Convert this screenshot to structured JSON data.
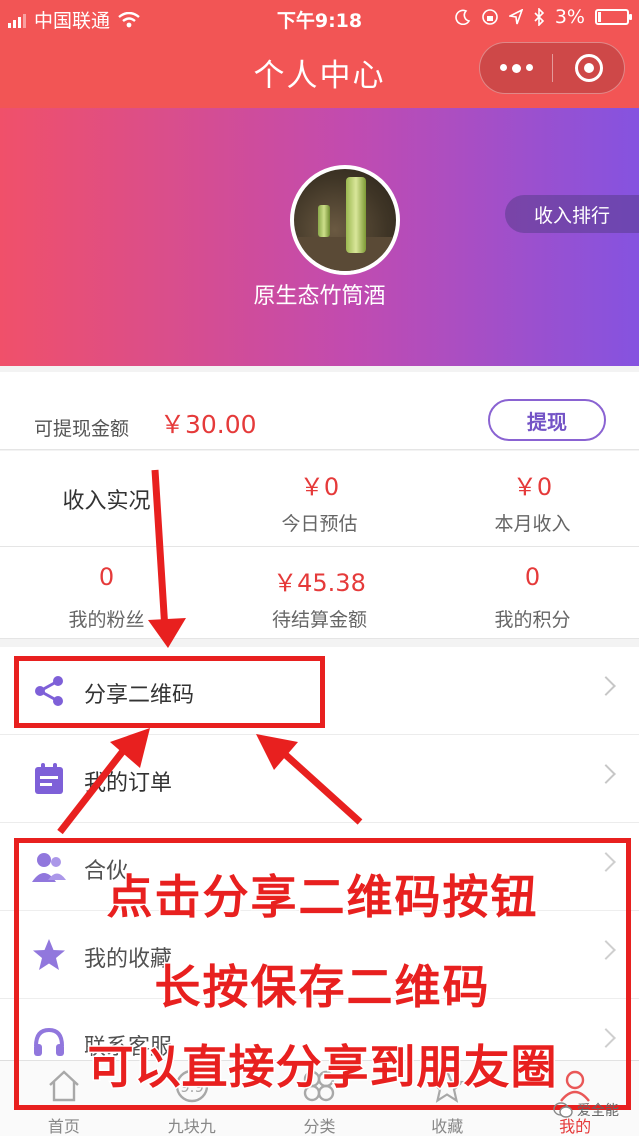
{
  "status_bar": {
    "carrier": "中国联通",
    "time": "下午9:18",
    "battery": "3%"
  },
  "nav": {
    "title": "个人中心"
  },
  "profile": {
    "name": "原生态竹筒酒",
    "rank_button": "收入排行"
  },
  "withdraw": {
    "label": "可提现金额",
    "amount": "￥30.00",
    "button": "提现"
  },
  "income": {
    "title": "收入实况",
    "today": {
      "value": "￥0",
      "label": "今日预估"
    },
    "month": {
      "value": "￥0",
      "label": "本月收入"
    }
  },
  "stats": [
    {
      "value": "0",
      "label": "我的粉丝"
    },
    {
      "value": "￥45.38",
      "label": "待结算金额"
    },
    {
      "value": "0",
      "label": "我的积分"
    }
  ],
  "menu": [
    {
      "label": "分享二维码",
      "icon": "share-icon"
    },
    {
      "label": "我的订单",
      "icon": "calendar-icon"
    },
    {
      "label": "合伙",
      "icon": "users-icon"
    },
    {
      "label": "我的收藏",
      "icon": "star-icon"
    },
    {
      "label": "联系客服",
      "icon": "service-icon"
    }
  ],
  "tabs": [
    {
      "label": "首页",
      "icon": "home-icon"
    },
    {
      "label": "九块九",
      "icon": "nine-icon"
    },
    {
      "label": "分类",
      "icon": "category-icon"
    },
    {
      "label": "收藏",
      "icon": "star-icon"
    },
    {
      "label": "我的",
      "icon": "user-icon"
    }
  ],
  "annotation": {
    "line1": "点击分享二维码按钮",
    "line2": "长按保存二维码",
    "line3": "可以直接分享到朋友圈"
  },
  "watermark": "爱全能",
  "colors": {
    "accent": "#f25555",
    "price": "#e53a3a",
    "purple": "#7353c6",
    "annotation": "#e8201f"
  }
}
